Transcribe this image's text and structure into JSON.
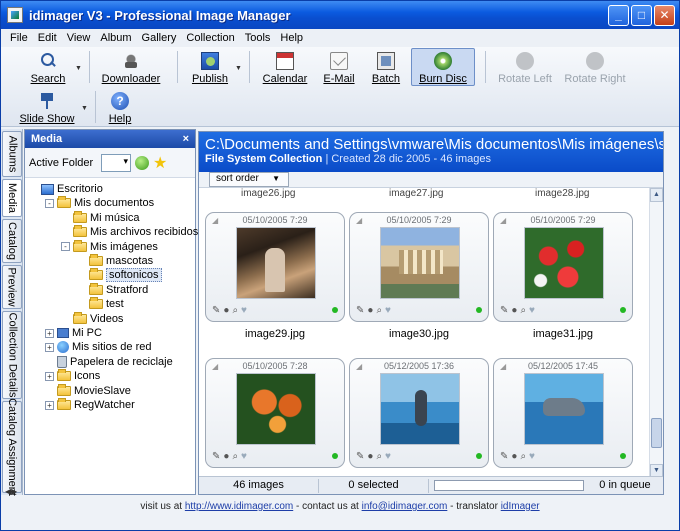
{
  "window": {
    "title": "idimager V3 - Professional Image Manager",
    "minimize": "_",
    "maximize": "□",
    "close": "✕"
  },
  "menu": [
    "File",
    "Edit",
    "View",
    "Album",
    "Gallery",
    "Collection",
    "Tools",
    "Help"
  ],
  "toolbar": {
    "search": "Search",
    "downloader": "Downloader",
    "publish": "Publish",
    "calendar": "Calendar",
    "email": "E-Mail",
    "batch": "Batch",
    "burn_disc": "Burn Disc",
    "rotate_left": "Rotate Left",
    "rotate_right": "Rotate Right",
    "slide_show": "Slide Show",
    "help": "Help",
    "help_glyph": "?"
  },
  "vtabs": [
    "Albums",
    "Media",
    "Catalog",
    "Preview",
    "Collection Details",
    "Catalog Assignment"
  ],
  "media_panel": {
    "title": "Media",
    "close": "×",
    "active_folder_label": "Active Folder",
    "star": "★",
    "tree": [
      {
        "label": "Escritorio",
        "icon": "desktop-icon",
        "level": 0,
        "expander": ""
      },
      {
        "label": "Mis documentos",
        "icon": "folder-icon",
        "level": 1,
        "expander": "-"
      },
      {
        "label": "Mi música",
        "icon": "folder-icon",
        "level": 2,
        "expander": ""
      },
      {
        "label": "Mis archivos recibidos",
        "icon": "folder-icon",
        "level": 2,
        "expander": ""
      },
      {
        "label": "Mis imágenes",
        "icon": "folder-icon",
        "level": 2,
        "expander": "-"
      },
      {
        "label": "mascotas",
        "icon": "folder-icon",
        "level": 3,
        "expander": ""
      },
      {
        "label": "softonicos",
        "icon": "folder-icon",
        "level": 3,
        "expander": "",
        "selected": true
      },
      {
        "label": "Stratford",
        "icon": "folder-icon",
        "level": 3,
        "expander": ""
      },
      {
        "label": "test",
        "icon": "folder-icon",
        "level": 3,
        "expander": ""
      },
      {
        "label": "Videos",
        "icon": "folder-icon",
        "level": 2,
        "expander": ""
      },
      {
        "label": "Mi PC",
        "icon": "computer-icon",
        "level": 1,
        "expander": "+"
      },
      {
        "label": "Mis sitios de red",
        "icon": "network-icon",
        "level": 1,
        "expander": "+"
      },
      {
        "label": "Papelera de reciclaje",
        "icon": "recycle-bin-icon",
        "level": 1,
        "expander": ""
      },
      {
        "label": "Icons",
        "icon": "folder-icon",
        "level": 1,
        "expander": "+"
      },
      {
        "label": "MovieSlave",
        "icon": "folder-icon",
        "level": 1,
        "expander": ""
      },
      {
        "label": "RegWatcher",
        "icon": "folder-icon",
        "level": 1,
        "expander": "+"
      }
    ]
  },
  "gallery": {
    "path": "C:\\Documents and Settings\\vmware\\Mis documentos\\Mis imágenes\\softonicos",
    "collection_label": "File System Collection",
    "created": "| Created 28 dic 2005",
    "count": "-  46 images",
    "sort_label": "sort order",
    "prev_row": [
      "image26.jpg",
      "image27.jpg",
      "image28.jpg"
    ],
    "thumbnails": [
      {
        "name": "image29.jpg",
        "date": "05/10/2005 7:29",
        "img": "img-29"
      },
      {
        "name": "image30.jpg",
        "date": "05/10/2005 7:29",
        "img": "img-30"
      },
      {
        "name": "image31.jpg",
        "date": "05/10/2005 7:29",
        "img": "img-31"
      },
      {
        "name": "",
        "date": "05/10/2005 7:28",
        "img": "img-32"
      },
      {
        "name": "",
        "date": "05/12/2005 17:36",
        "img": "img-33"
      },
      {
        "name": "",
        "date": "05/12/2005 17:45",
        "img": "img-34"
      }
    ],
    "status": {
      "images": "46 images",
      "selected": "0 selected",
      "queue": "0 in queue"
    }
  },
  "footer": {
    "text1": "visit us at",
    "link1": "http://www.idimager.com",
    "text2": " - contact us at",
    "link2": "info@idimager.com",
    "text3": " - translator",
    "link3": "idImager"
  }
}
